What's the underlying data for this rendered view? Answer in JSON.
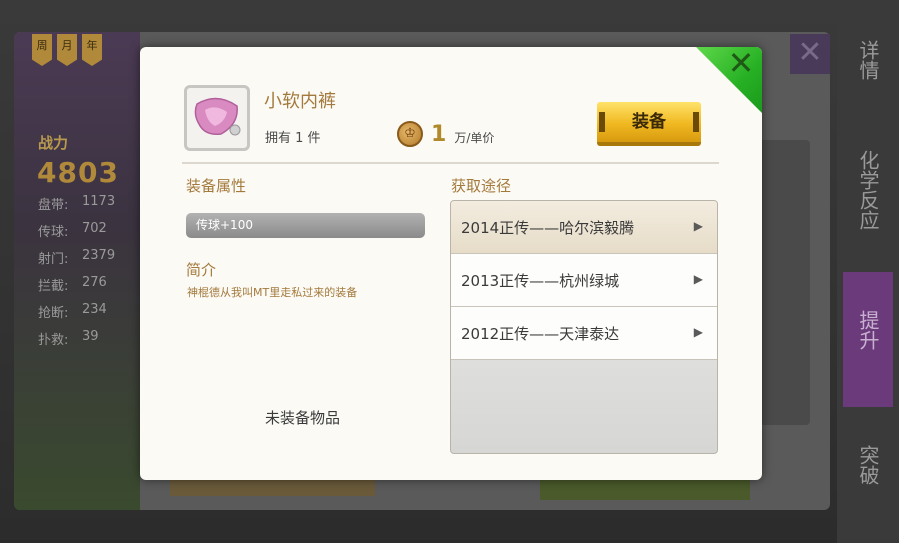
{
  "background": {
    "ribbons": [
      "周",
      "月",
      "年"
    ],
    "power_label": "战力",
    "power_value": "4803",
    "stats": [
      {
        "label": "盘带:",
        "value": "1173"
      },
      {
        "label": "传球:",
        "value": "702"
      },
      {
        "label": "射门:",
        "value": "2379"
      },
      {
        "label": "拦截:",
        "value": "276"
      },
      {
        "label": "抢断:",
        "value": "234"
      },
      {
        "label": "扑救:",
        "value": "39"
      }
    ],
    "side_tabs": [
      "详情",
      "化学反应",
      "提升",
      "突破"
    ],
    "active_side_tab": "提升",
    "close_glyph": "✕"
  },
  "dialog": {
    "item_name": "小软内裤",
    "own_text": "拥有 1 件",
    "price_amount": "1",
    "price_unit": "万/单价",
    "equip_label": "装备",
    "close_glyph": "✕",
    "attributes_title": "装备属性",
    "attributes": [
      "传球+100"
    ],
    "intro_title": "简介",
    "intro_text": "神棍德从我叫MT里走私过来的装备",
    "unequipped_text": "未装备物品",
    "sources_title": "获取途径",
    "sources": [
      {
        "label": "2014正传——哈尔滨毅腾",
        "active": true
      },
      {
        "label": "2013正传——杭州绿城",
        "active": false
      },
      {
        "label": "2012正传——天津泰达",
        "active": false
      }
    ],
    "arrow_glyph": "▶"
  },
  "colors": {
    "accent_gold": "#a47a3c",
    "close_green": "#27b024",
    "equip_yellow": "#f0b820"
  }
}
